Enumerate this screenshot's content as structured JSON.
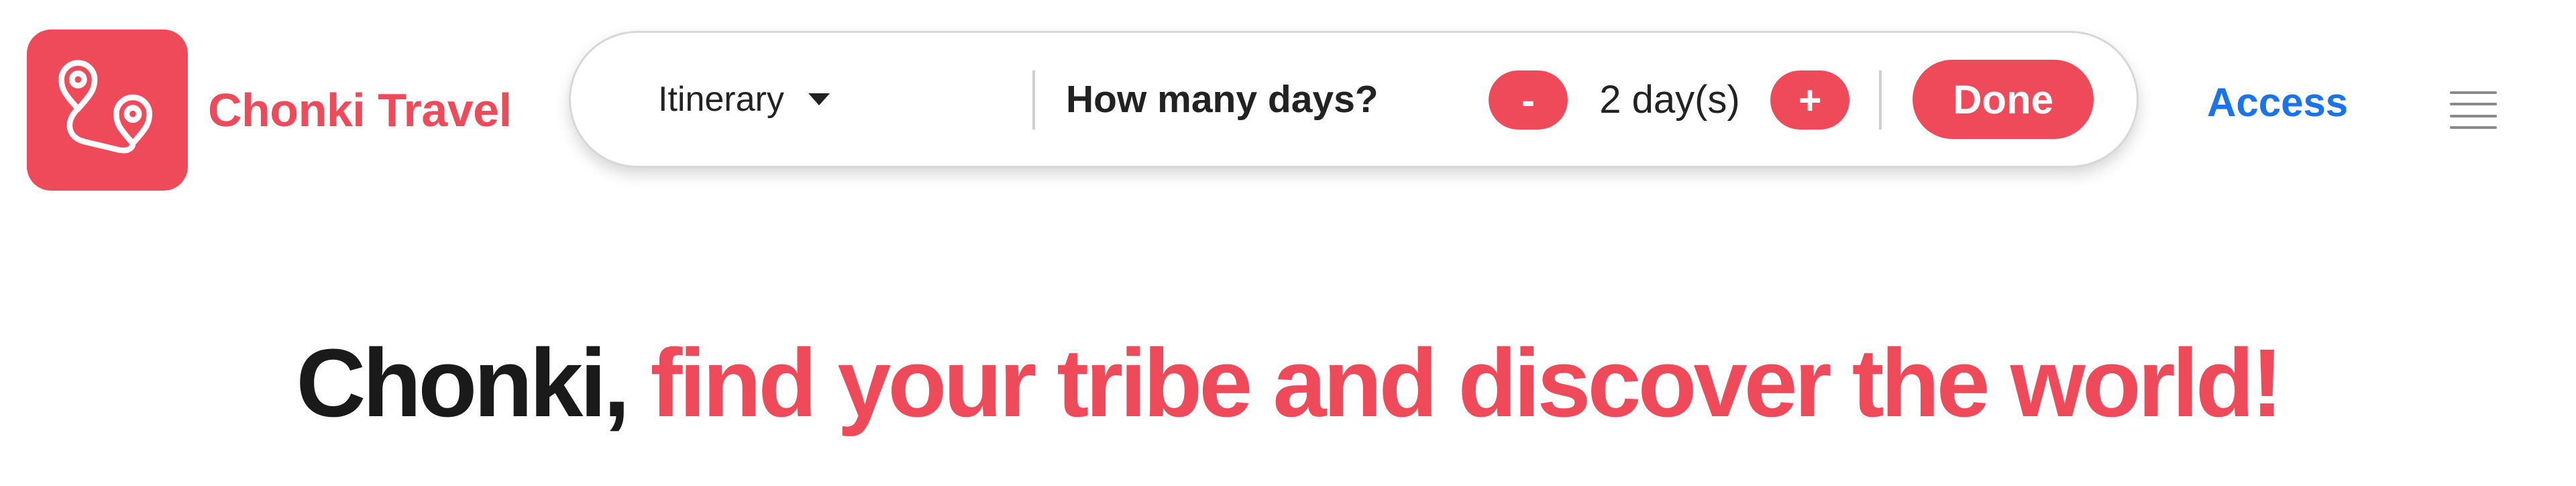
{
  "brand": {
    "name": "Chonki Travel",
    "logo_icon": "map-route-pins-icon",
    "color": "#ef4a5a"
  },
  "search": {
    "itinerary_label": "Itinerary",
    "days_question": "How many days?",
    "decrement_label": "-",
    "increment_label": "+",
    "days_value": "2 day(s)",
    "done_label": "Done"
  },
  "nav": {
    "access_label": "Access",
    "access_color": "#1a73e8",
    "menu_icon": "hamburger-menu-icon"
  },
  "hero": {
    "brand_part": "Chonki,",
    "tagline": "find your tribe and discover the world!"
  }
}
